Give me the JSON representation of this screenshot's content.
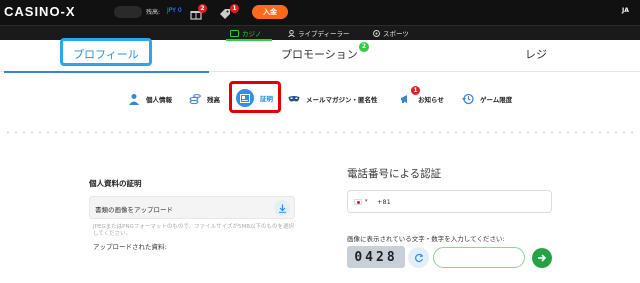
{
  "header": {
    "logo": "CASINO-X",
    "balance_label": "残高:",
    "balance_value": "JPY 0",
    "gift_badge": "2",
    "promo_badge": "1",
    "deposit_label": "入金",
    "language": "JA"
  },
  "subnav": {
    "items": [
      {
        "label": "カジノ",
        "icon": "casino-icon"
      },
      {
        "label": "ライブディーラー",
        "icon": "dealer-icon"
      },
      {
        "label": "スポーツ",
        "icon": "sports-icon"
      }
    ],
    "active_color": "#2ecc40"
  },
  "tabs": {
    "profile": "プロフィール",
    "promotions": "プロモーション",
    "promotions_badge": "2",
    "cashier": "レジ"
  },
  "section_nav": {
    "personal": "個人情報",
    "balance": "残高",
    "verification": "証明",
    "newsletter": "メールマガジン・匿名性",
    "notices": "お知らせ",
    "notices_badge": "1",
    "game_limits": "ゲーム限度"
  },
  "documents": {
    "title": "個人資料の証明",
    "upload_placeholder": "書類の画像をアップロード",
    "hint": "JPEGまたはPNGフォーマットのもので、ファイルサイズが5MB以下のものを選択してください。",
    "uploaded_label": "アップロードされた資料:"
  },
  "phone": {
    "title": "電話番号による認証",
    "country_code": "+81",
    "captcha_label": "画像に表示されている文字・数字を入力してください:",
    "captcha_text": "0428"
  },
  "colors": {
    "accent_blue": "#2aa8ec",
    "highlight_red": "#e00000",
    "deposit_orange": "#ff6a1a",
    "go_green": "#25a244"
  }
}
